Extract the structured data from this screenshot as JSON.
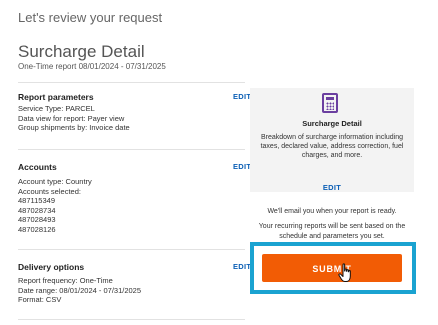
{
  "header": {
    "review_text": "Let's review your request",
    "title": "Surcharge Detail",
    "subtitle": "One-Time report 08/01/2024 - 07/31/2025"
  },
  "sections": {
    "report_parameters": {
      "title": "Report parameters",
      "edit_label": "EDIT",
      "lines": [
        "Service Type:  PARCEL",
        "Data view for report:  Payer view",
        "Group shipments by:  Invoice date"
      ]
    },
    "accounts": {
      "title": "Accounts",
      "edit_label": "EDIT",
      "lines": [
        "Account type:  Country",
        "Accounts selected:",
        "487115349",
        "487028734",
        "487028493",
        "487028126"
      ]
    },
    "delivery_options": {
      "title": "Delivery options",
      "edit_label": "EDIT",
      "lines": [
        "Report frequency:  One-Time",
        "Date range:  08/01/2024 - 07/31/2025",
        "Format:  CSV"
      ]
    }
  },
  "card": {
    "icon": "calculator-icon",
    "title": "Surcharge Detail",
    "description": "Breakdown of surcharge information including taxes, declared value, address correction, fuel charges, and more.",
    "edit_label": "EDIT"
  },
  "notes": {
    "email": "We'll email you when your report is ready.",
    "recurring": "Your recurring reports will be sent based on the schedule and parameters you set."
  },
  "submit_label": "SUBMIT",
  "colors": {
    "accent": "#f25c05",
    "link": "#0b5fb6",
    "highlight": "#1aa3d1",
    "icon": "#6b3fa0"
  }
}
